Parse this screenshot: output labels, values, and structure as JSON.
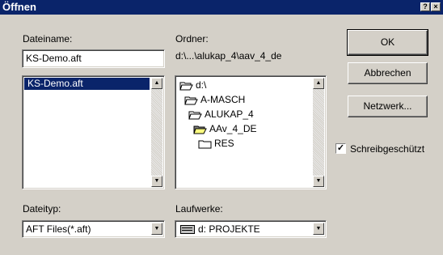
{
  "window": {
    "title": "Öffnen",
    "help_glyph": "?",
    "close_glyph": "×"
  },
  "filename": {
    "label": "Dateiname:",
    "value": "KS-Demo.aft",
    "list": [
      "KS-Demo.aft"
    ]
  },
  "folder": {
    "label": "Ordner:",
    "path": "d:\\...\\alukap_4\\aav_4_de",
    "tree": [
      {
        "name": "d:\\",
        "icon": "open-folder-icon"
      },
      {
        "name": "A-MASCH",
        "icon": "open-folder-icon"
      },
      {
        "name": "ALUKAP_4",
        "icon": "open-folder-icon"
      },
      {
        "name": "AAv_4_DE",
        "icon": "open-folder-icon"
      },
      {
        "name": "RES",
        "icon": "folder-icon"
      }
    ]
  },
  "filetype": {
    "label": "Dateityp:",
    "value": "AFT Files(*.aft)"
  },
  "drives": {
    "label": "Laufwerke:",
    "value": "d: PROJEKTE",
    "icon": "drive-icon"
  },
  "buttons": {
    "ok": "OK",
    "cancel": "Abbrechen",
    "network": "Netzwerk..."
  },
  "readonly": {
    "label": "Schreibgeschützt",
    "checked": true,
    "mark": "✓"
  },
  "colors": {
    "titlebar": "#0a246a",
    "face": "#d4d0c8",
    "selection": "#0a246a"
  }
}
